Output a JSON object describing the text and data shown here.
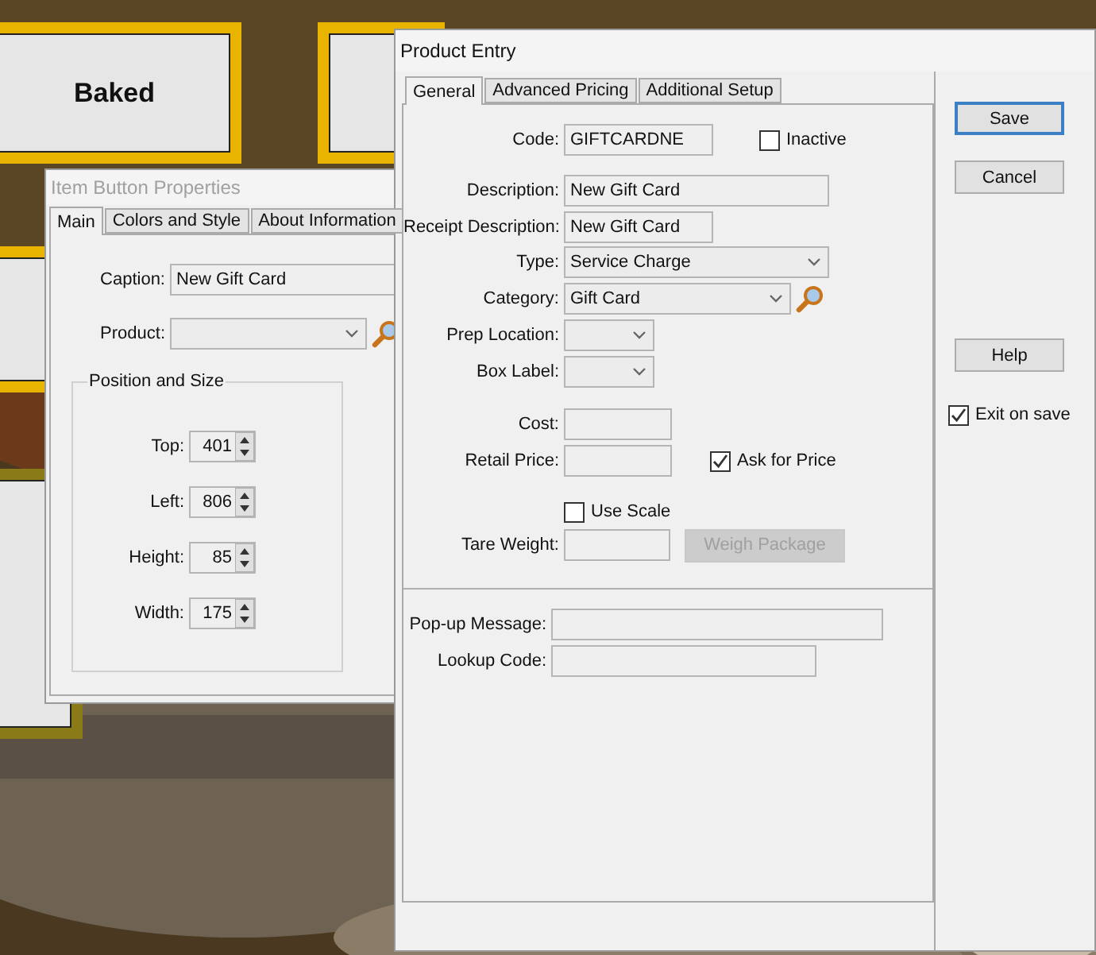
{
  "pos_tiles": [
    {
      "label": "Baked"
    }
  ],
  "item_button_properties": {
    "title": "Item Button Properties",
    "active": false,
    "tabs": [
      {
        "label": "Main",
        "selected": true
      },
      {
        "label": "Colors and Style",
        "selected": false
      },
      {
        "label": "About Information",
        "selected": false
      }
    ],
    "caption": {
      "label": "Caption:",
      "value": "New Gift Card"
    },
    "product": {
      "label": "Product:"
    },
    "position_group": {
      "title": "Position and Size",
      "fields": [
        {
          "label": "Top:",
          "value": "401"
        },
        {
          "label": "Left:",
          "value": "806"
        },
        {
          "label": "Height:",
          "value": "85"
        },
        {
          "label": "Width:",
          "value": "175"
        }
      ]
    }
  },
  "product_entry": {
    "title": "Product Entry",
    "active": true,
    "tabs": [
      {
        "label": "General",
        "selected": true
      },
      {
        "label": "Advanced Pricing",
        "selected": false
      },
      {
        "label": "Additional Setup",
        "selected": false
      }
    ],
    "code": {
      "label": "Code:",
      "value": "GIFTCARDNE"
    },
    "inactive": {
      "label": "Inactive",
      "checked": false
    },
    "description": {
      "label": "Description:",
      "value": "New Gift Card"
    },
    "receipt_description": {
      "label": "Receipt Description:",
      "value": "New Gift Card"
    },
    "type": {
      "label": "Type:",
      "value": "Service Charge"
    },
    "category": {
      "label": "Category:",
      "value": "Gift Card"
    },
    "prep_location": {
      "label": "Prep Location:"
    },
    "box_label": {
      "label": "Box Label:"
    },
    "cost": {
      "label": "Cost:"
    },
    "retail_price": {
      "label": "Retail Price:"
    },
    "ask_for_price": {
      "label": "Ask for Price",
      "checked": true
    },
    "use_scale": {
      "label": "Use Scale",
      "checked": false
    },
    "tare_weight": {
      "label": "Tare Weight:"
    },
    "weigh_package": {
      "label": "Weigh Package",
      "disabled": true
    },
    "popup_message": {
      "label": "Pop-up Message:"
    },
    "lookup_code": {
      "label": "Lookup Code:"
    },
    "buttons": [
      {
        "label": "Save",
        "focused": true
      },
      {
        "label": "Cancel",
        "focused": false
      },
      {
        "label": "Help",
        "focused": false
      }
    ],
    "exit_on_save": {
      "label": "Exit on save",
      "checked": true
    }
  }
}
